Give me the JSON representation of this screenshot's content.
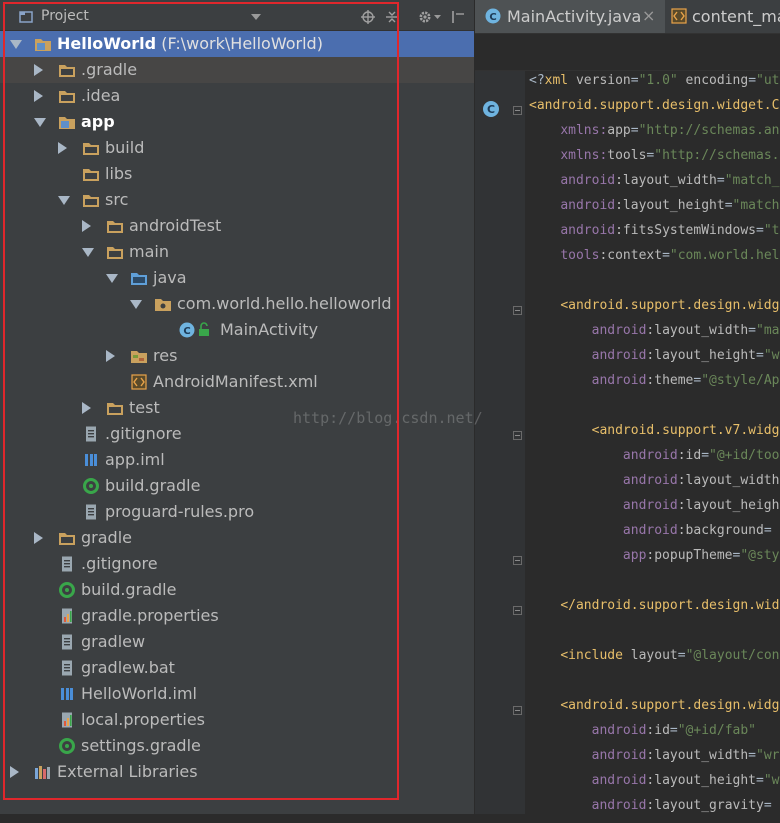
{
  "project_panel": {
    "title": "Project",
    "tree": [
      {
        "label": "HelloWorld",
        "path": "(F:\\work\\HelloWorld)",
        "icon": "module-folder-icon",
        "bold": true,
        "expanded": true
      },
      {
        "label": ".gradle",
        "icon": "folder-icon"
      },
      {
        "label": ".idea",
        "icon": "folder-icon"
      },
      {
        "label": "app",
        "icon": "module-folder-icon",
        "bold": true,
        "expanded": true
      },
      {
        "label": "build",
        "icon": "folder-icon"
      },
      {
        "label": "libs",
        "icon": "folder-icon"
      },
      {
        "label": "src",
        "icon": "folder-icon",
        "expanded": true
      },
      {
        "label": "androidTest",
        "icon": "folder-icon"
      },
      {
        "label": "main",
        "icon": "folder-icon",
        "expanded": true
      },
      {
        "label": "java",
        "icon": "source-folder-icon",
        "expanded": true
      },
      {
        "label": "com.world.hello.helloworld",
        "icon": "package-icon",
        "expanded": true
      },
      {
        "label": "MainActivity",
        "icon": "class-icon"
      },
      {
        "label": "res",
        "icon": "resource-folder-icon"
      },
      {
        "label": "AndroidManifest.xml",
        "icon": "xml-file-icon"
      },
      {
        "label": "test",
        "icon": "folder-icon"
      },
      {
        "label": ".gitignore",
        "icon": "text-file-icon"
      },
      {
        "label": "app.iml",
        "icon": "iml-file-icon"
      },
      {
        "label": "build.gradle",
        "icon": "gradle-file-icon"
      },
      {
        "label": "proguard-rules.pro",
        "icon": "text-file-icon"
      },
      {
        "label": "gradle",
        "icon": "folder-icon"
      },
      {
        "label": ".gitignore",
        "icon": "text-file-icon"
      },
      {
        "label": "build.gradle",
        "icon": "gradle-file-icon"
      },
      {
        "label": "gradle.properties",
        "icon": "properties-file-icon"
      },
      {
        "label": "gradlew",
        "icon": "text-file-icon"
      },
      {
        "label": "gradlew.bat",
        "icon": "text-file-icon"
      },
      {
        "label": "HelloWorld.iml",
        "icon": "iml-file-icon"
      },
      {
        "label": "local.properties",
        "icon": "properties-file-icon"
      },
      {
        "label": "settings.gradle",
        "icon": "gradle-file-icon"
      },
      {
        "label": "External Libraries",
        "icon": "libraries-icon"
      }
    ]
  },
  "editor": {
    "tabs": [
      {
        "label": "MainActivity.java",
        "close": "×"
      },
      {
        "label": "content_ma"
      }
    ],
    "code_lines": [
      [
        [
          "plain",
          "<?"
        ],
        [
          "tag",
          "xml "
        ],
        [
          "attr",
          "version"
        ],
        [
          "plain",
          "="
        ],
        [
          "val",
          "\"1.0\""
        ],
        [
          "attr",
          " encoding"
        ],
        [
          "plain",
          "="
        ],
        [
          "val",
          "\"ut"
        ]
      ],
      [
        [
          "tag",
          "<android.support.design.widget.C"
        ]
      ],
      [
        [
          "plain",
          "    "
        ],
        [
          "ns",
          "xmlns:"
        ],
        [
          "attr",
          "app"
        ],
        [
          "plain",
          "="
        ],
        [
          "val",
          "\"http://schemas.an"
        ]
      ],
      [
        [
          "plain",
          "    "
        ],
        [
          "ns",
          "xmlns:"
        ],
        [
          "attr",
          "tools"
        ],
        [
          "plain",
          "="
        ],
        [
          "val",
          "\"http://schemas."
        ]
      ],
      [
        [
          "plain",
          "    "
        ],
        [
          "ns",
          "android"
        ],
        [
          "attr",
          ":layout_width"
        ],
        [
          "plain",
          "="
        ],
        [
          "val",
          "\"match_"
        ]
      ],
      [
        [
          "plain",
          "    "
        ],
        [
          "ns",
          "android"
        ],
        [
          "attr",
          ":layout_height"
        ],
        [
          "plain",
          "="
        ],
        [
          "val",
          "\"match"
        ]
      ],
      [
        [
          "plain",
          "    "
        ],
        [
          "ns",
          "android"
        ],
        [
          "attr",
          ":fitsSystemWindows"
        ],
        [
          "plain",
          "="
        ],
        [
          "val",
          "\"t"
        ]
      ],
      [
        [
          "plain",
          "    "
        ],
        [
          "ns",
          "tools"
        ],
        [
          "attr",
          ":context"
        ],
        [
          "plain",
          "="
        ],
        [
          "val",
          "\"com.world.hel"
        ]
      ],
      [
        [
          "plain",
          ""
        ]
      ],
      [
        [
          "plain",
          "    "
        ],
        [
          "tag",
          "<android.support.design.widg"
        ]
      ],
      [
        [
          "plain",
          "        "
        ],
        [
          "ns",
          "android"
        ],
        [
          "attr",
          ":layout_width"
        ],
        [
          "plain",
          "="
        ],
        [
          "val",
          "\"ma"
        ]
      ],
      [
        [
          "plain",
          "        "
        ],
        [
          "ns",
          "android"
        ],
        [
          "attr",
          ":layout_height"
        ],
        [
          "plain",
          "="
        ],
        [
          "val",
          "\"w"
        ]
      ],
      [
        [
          "plain",
          "        "
        ],
        [
          "ns",
          "android"
        ],
        [
          "attr",
          ":theme"
        ],
        [
          "plain",
          "="
        ],
        [
          "val",
          "\"@style/Ap"
        ]
      ],
      [
        [
          "plain",
          ""
        ]
      ],
      [
        [
          "plain",
          "        "
        ],
        [
          "tag",
          "<android.support.v7.widg"
        ]
      ],
      [
        [
          "plain",
          "            "
        ],
        [
          "ns",
          "android"
        ],
        [
          "attr",
          ":id"
        ],
        [
          "plain",
          "="
        ],
        [
          "val",
          "\"@+id/too"
        ]
      ],
      [
        [
          "plain",
          "            "
        ],
        [
          "ns",
          "android"
        ],
        [
          "attr",
          ":layout_width"
        ]
      ],
      [
        [
          "plain",
          "            "
        ],
        [
          "ns",
          "android"
        ],
        [
          "attr",
          ":layout_heigh"
        ]
      ],
      [
        [
          "plain",
          "            "
        ],
        [
          "ns",
          "android"
        ],
        [
          "attr",
          ":background"
        ],
        [
          "plain",
          "="
        ]
      ],
      [
        [
          "plain",
          "            "
        ],
        [
          "ns",
          "app"
        ],
        [
          "attr",
          ":popupTheme"
        ],
        [
          "plain",
          "="
        ],
        [
          "val",
          "\"@sty"
        ]
      ],
      [
        [
          "plain",
          ""
        ]
      ],
      [
        [
          "plain",
          "    "
        ],
        [
          "tag",
          "</android.support.design.wid"
        ]
      ],
      [
        [
          "plain",
          ""
        ]
      ],
      [
        [
          "plain",
          "    "
        ],
        [
          "tag",
          "<include "
        ],
        [
          "attr",
          "layout"
        ],
        [
          "plain",
          "="
        ],
        [
          "val",
          "\"@layout/con"
        ]
      ],
      [
        [
          "plain",
          ""
        ]
      ],
      [
        [
          "plain",
          "    "
        ],
        [
          "tag",
          "<android.support.design.widg"
        ]
      ],
      [
        [
          "plain",
          "        "
        ],
        [
          "ns",
          "android"
        ],
        [
          "attr",
          ":id"
        ],
        [
          "plain",
          "="
        ],
        [
          "val",
          "\"@+id/fab\""
        ]
      ],
      [
        [
          "plain",
          "        "
        ],
        [
          "ns",
          "android"
        ],
        [
          "attr",
          ":layout_width"
        ],
        [
          "plain",
          "="
        ],
        [
          "val",
          "\"wr"
        ]
      ],
      [
        [
          "plain",
          "        "
        ],
        [
          "ns",
          "android"
        ],
        [
          "attr",
          ":layout_height"
        ],
        [
          "plain",
          "="
        ],
        [
          "val",
          "\"w"
        ]
      ],
      [
        [
          "plain",
          "        "
        ],
        [
          "ns",
          "android"
        ],
        [
          "attr",
          ":layout_gravity"
        ],
        [
          "plain",
          "="
        ]
      ]
    ]
  },
  "watermark": "http://blog.csdn.net/"
}
